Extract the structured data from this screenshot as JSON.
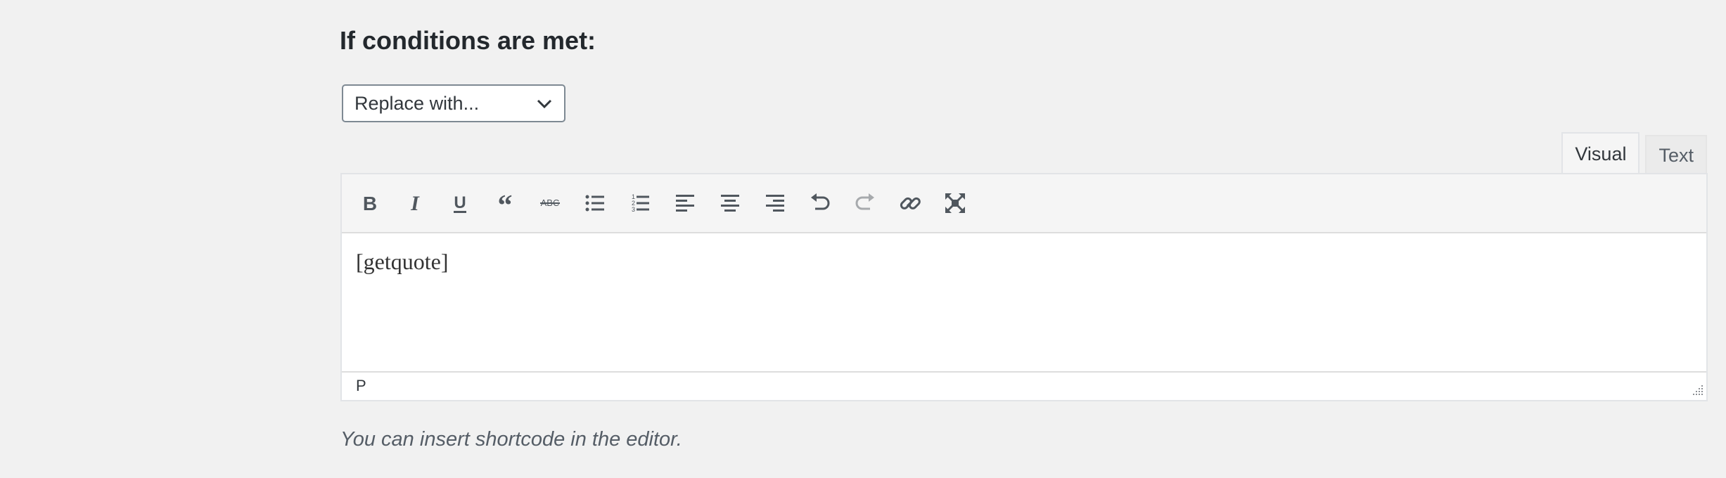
{
  "section": {
    "heading": "If conditions are met:"
  },
  "action_select": {
    "selected": "Replace with..."
  },
  "editor": {
    "tabs": [
      {
        "label": "Visual",
        "active": true
      },
      {
        "label": "Text",
        "active": false
      }
    ],
    "toolbar": [
      "bold-icon",
      "italic-icon",
      "underline-icon",
      "blockquote-icon",
      "strikethrough-icon",
      "bulleted-list-icon",
      "numbered-list-icon",
      "align-left-icon",
      "align-center-icon",
      "align-right-icon",
      "undo-icon",
      "redo-icon",
      "link-icon",
      "fullscreen-icon"
    ],
    "content": "[getquote]",
    "status_path": "P"
  },
  "help_text": "You can insert shortcode in the editor.",
  "colors": {
    "background": "#f1f1f1",
    "icon": "#50575e",
    "icon_disabled": "#a7aaad"
  }
}
